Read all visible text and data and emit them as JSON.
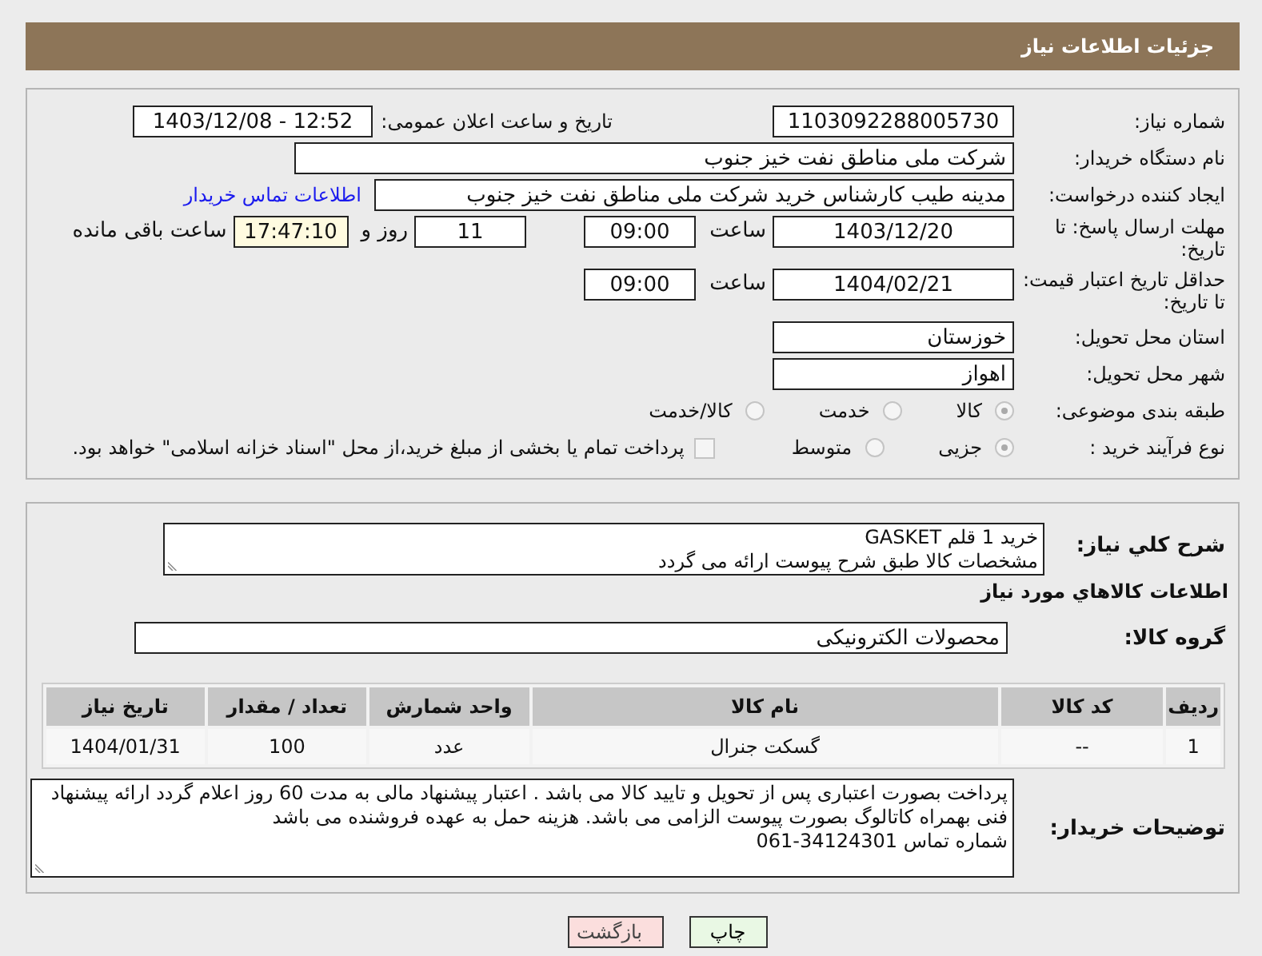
{
  "header": {
    "title": "جزئیات اطلاعات نیاز"
  },
  "details": {
    "need_number": {
      "label": "شماره نیاز:",
      "value": "1103092288005730"
    },
    "announce": {
      "label": "تاریخ و ساعت اعلان عمومی:",
      "value": "1403/12/08 - 12:52"
    },
    "buyer": {
      "label": "نام دستگاه خریدار:",
      "value": "شرکت ملی مناطق نفت خیز جنوب"
    },
    "creator": {
      "label": "ایجاد کننده درخواست:",
      "value": "مدینه طیب کارشناس خرید شرکت ملی مناطق نفت خیز جنوب",
      "link": "اطلاعات تماس خریدار"
    },
    "deadline": {
      "label": "مهلت ارسال پاسخ: تا تاریخ:",
      "date": "1403/12/20",
      "time_label": "ساعت",
      "time": "09:00",
      "days": "11",
      "days_label": "روز و",
      "remaining": "17:47:10",
      "remaining_label": "ساعت باقی مانده"
    },
    "validity": {
      "label": "حداقل تاریخ اعتبار قیمت: تا تاریخ:",
      "date": "1404/02/21",
      "time_label": "ساعت",
      "time": "09:00"
    },
    "province": {
      "label": "استان محل تحویل:",
      "value": "خوزستان"
    },
    "city": {
      "label": "شهر محل تحویل:",
      "value": "اهواز"
    },
    "category": {
      "label": "طبقه بندی موضوعی:",
      "options": [
        {
          "label": "کالا",
          "selected": true
        },
        {
          "label": "خدمت",
          "selected": false
        },
        {
          "label": "کالا/خدمت",
          "selected": false
        }
      ]
    },
    "process": {
      "label": "نوع فرآیند خرید :",
      "options": [
        {
          "label": "جزیی",
          "selected": true
        },
        {
          "label": "متوسط",
          "selected": false
        }
      ],
      "treasury": {
        "checked": false,
        "label": "پرداخت تمام یا بخشی از مبلغ خرید،از محل \"اسناد خزانه اسلامی\" خواهد بود."
      }
    }
  },
  "summary": {
    "label": "شرح کلي نياز:",
    "lines": [
      "خرید 1 قلم GASKET",
      "مشخصات کالا طبق شرح پیوست ارائه می گردد"
    ]
  },
  "goods": {
    "heading": "اطلاعات كالاهاي مورد نياز",
    "group_label": "گروه کالا:",
    "group": "محصولات الکترونیکی",
    "columns": [
      "ردیف",
      "کد کالا",
      "نام کالا",
      "واحد شمارش",
      "تعداد / مقدار",
      "تاریخ نیاز"
    ],
    "rows": [
      [
        "1",
        "--",
        "گسکت جنرال",
        "عدد",
        "100",
        "1404/01/31"
      ]
    ]
  },
  "notes": {
    "label": "توضیحات خریدار:",
    "lines": [
      "پرداخت بصورت اعتباری پس از تحویل و تایید کالا می باشد . اعتبار پیشنهاد مالی به مدت 60 روز اعلام گردد  ارائه پیشنهاد",
      "فنی بهمراه کاتالوگ بصورت پیوست الزامی می باشد. هزینه حمل به عهده فروشنده می باشد",
      "شماره تماس 34124301-061"
    ]
  },
  "buttons": [
    {
      "kind": "print",
      "label": "چاپ"
    },
    {
      "kind": "back",
      "label": "بازگشت"
    }
  ]
}
